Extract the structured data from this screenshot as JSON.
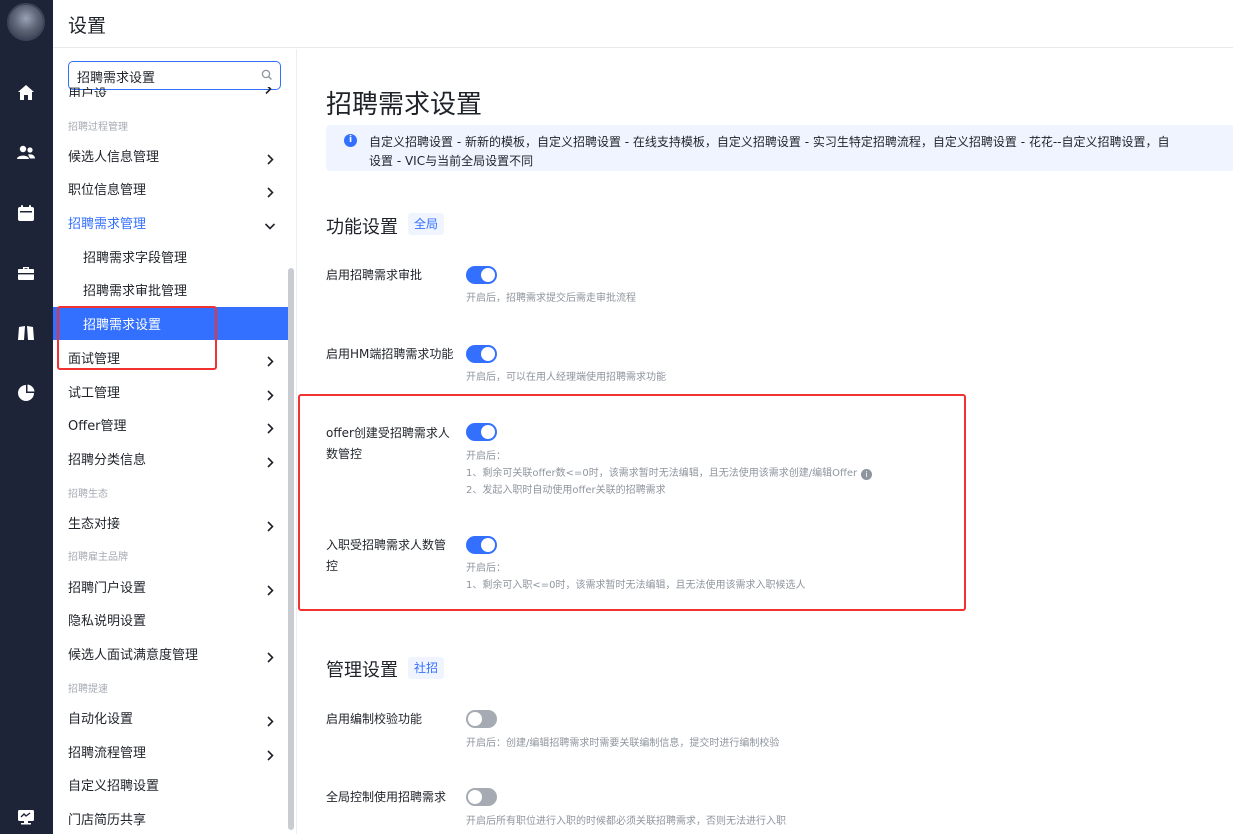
{
  "header": {
    "title": "设置"
  },
  "sidebar": {
    "search": {
      "value": "招聘需求设置"
    },
    "partial_item": "用户设置",
    "groups": {
      "g1": "招聘过程管理",
      "g2": "招聘生态",
      "g3": "招聘雇主品牌",
      "g4": "招聘提速"
    },
    "items": {
      "candidate_info": "候选人信息管理",
      "position_info": "职位信息管理",
      "requirement_mgmt": "招聘需求管理",
      "req_field": "招聘需求字段管理",
      "req_approval": "招聘需求审批管理",
      "req_settings": "招聘需求设置",
      "interview": "面试管理",
      "trial": "试工管理",
      "offer": "Offer管理",
      "category": "招聘分类信息",
      "eco_connect": "生态对接",
      "portal": "招聘门户设置",
      "privacy": "隐私说明设置",
      "satisfaction": "候选人面试满意度管理",
      "automation": "自动化设置",
      "process": "招聘流程管理",
      "custom": "自定义招聘设置",
      "store_share": "门店简历共享"
    }
  },
  "main": {
    "title": "招聘需求设置",
    "notice_line1": "自定义招聘设置 - 新新的模板，自定义招聘设置 - 在线支持模板，自定义招聘设置 - 实习生特定招聘流程，自定义招聘设置 - 花花--自定义招聘设置，自",
    "notice_line2": "设置 - VIC与当前全局设置不同",
    "func_section": {
      "title": "功能设置",
      "tag": "全局"
    },
    "settings": {
      "s1": {
        "label": "启用招聘需求审批",
        "state": "on",
        "desc": "开启后，招聘需求提交后需走审批流程"
      },
      "s2": {
        "label": "启用HM端招聘需求功能",
        "state": "on",
        "desc": "开启后，可以在用人经理端使用招聘需求功能"
      },
      "s3": {
        "label": "offer创建受招聘需求人数管控",
        "state": "on",
        "desc1": "开启后：",
        "desc2": "1、剩余可关联offer数<=0时，该需求暂时无法编辑，且无法使用该需求创建/编辑Offer",
        "desc3": "2、发起入职时自动使用offer关联的招聘需求"
      },
      "s4": {
        "label": "入职受招聘需求人数管控",
        "state": "on",
        "desc1": "开启后：",
        "desc2": "1、剩余可入职<=0时，该需求暂时无法编辑，且无法使用该需求入职候选人"
      },
      "s5": {
        "label": "启用编制校验功能",
        "state": "off",
        "desc": "开启后：创建/编辑招聘需求时需要关联编制信息，提交时进行编制校验"
      },
      "s6": {
        "label": "全局控制使用招聘需求",
        "state": "off",
        "desc": "开启后所有职位进行入职的时候都必须关联招聘需求，否则无法进行入职"
      }
    },
    "mgmt_section": {
      "title": "管理设置",
      "tag": "社招"
    }
  },
  "colors": {
    "accent": "#3370ff",
    "rail": "#1d2438",
    "highlight": "#f03232",
    "toggle_off": "#a6abb3"
  },
  "icons": [
    "home-icon",
    "users-icon",
    "calendar-icon",
    "briefcase-icon",
    "book-icon",
    "pie-chart-icon",
    "monitor-icon",
    "search-icon",
    "info-icon"
  ]
}
